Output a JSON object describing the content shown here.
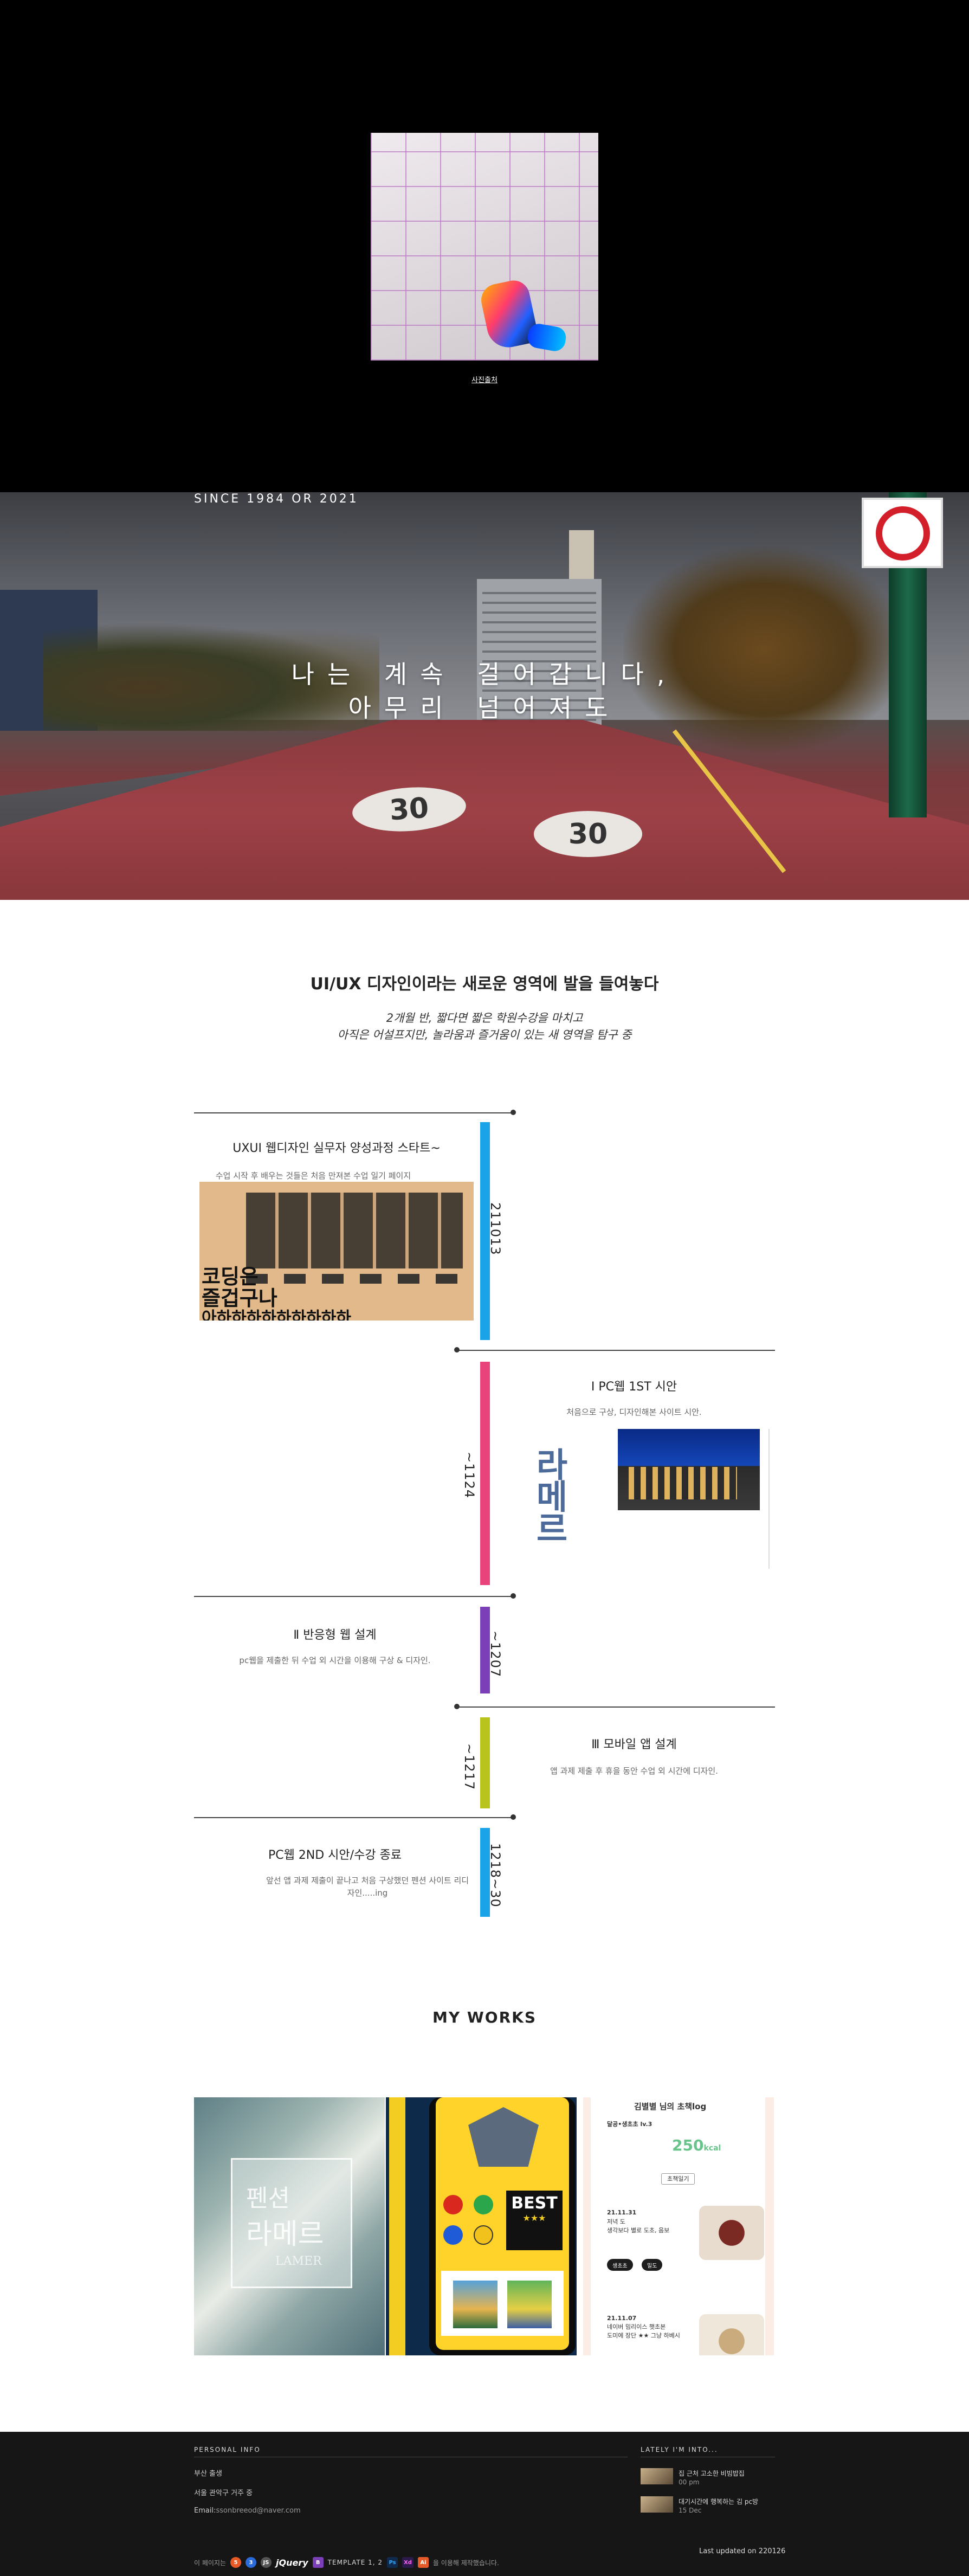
{
  "intro": {
    "caption": "사진출처"
  },
  "hero": {
    "since": "SINCE 1984 OR 2021",
    "line1": "나는 계속 걸어갑니다,",
    "line2": "아무리 넘어져도",
    "road_mark1": "30",
    "road_mark2": "30"
  },
  "about": {
    "title": "UI/UX 디자인이라는 새로운 영역에 발을 들여놓다",
    "sub1": "2개월 반, 짧다면 짧은 학원수강을 마치고",
    "sub2": "아직은 어설프지만, 놀라움과 즐거움이 있는 새 영역을 탐구 중"
  },
  "timeline": [
    {
      "date": "211013",
      "title": "UXUI 웹디자인 실무자 양성과정 스타트~",
      "desc": "수업 시작 후 배우는 것들은 처음 만져본 수업 일기 페이지",
      "thumb_text1": "코딩은",
      "thumb_text2": "즐겁구나",
      "thumb_text3": "아하하하하하하하하하",
      "color": "#1aa3e8"
    },
    {
      "date": "~1124",
      "title": "Ⅰ PC웹 1ST 시안",
      "desc": "처음으로 구상, 디자인해본 사이트 시안.",
      "thumb_logo": "라메르",
      "color": "#e8437a"
    },
    {
      "date": "~1207",
      "title": "Ⅱ 반응형 웹 설계",
      "desc": "pc웹을 제출한 뒤 수업 외 시간을 이용해 구상 & 디자인.",
      "color": "#7b3fb8"
    },
    {
      "date": "~1217",
      "title": "Ⅲ 모바일 앱 설계",
      "desc": "앱 과제 제출 후 휴을 동안 수업 외 시간에 디자인.",
      "color": "#b8c41d"
    },
    {
      "date": "1218~30",
      "title": "PC웹 2ND 시안/수강 종료",
      "desc1": "앞선 앱 과제 제출이 끝나고 처음 구상했던 펜션 사이트 리디",
      "desc2": "자인.....ing",
      "color": "#1aa3e8"
    }
  ],
  "works": {
    "title": "MY WORKS",
    "w1": {
      "name1": "펜션",
      "name2": "라메르",
      "name3": "LAMER"
    },
    "w2": {
      "best": "BEST",
      "best2": "★★★"
    },
    "w3": {
      "title": "김별별 님의 초책log",
      "tag": "달공•생초초 lv.3",
      "kcal": "250",
      "kcal_unit": "kcal",
      "btn": "초책일기",
      "e1_date": "21.11.31",
      "e1_line1": "저녁 도",
      "e1_line2": "생각보다 별로 도초, 음보",
      "pill1": "생초초",
      "pill2": "밀도",
      "e2_date": "21.11.07",
      "e2_line1": "네이버 밈리이스 햇초본",
      "e2_line2": "도미에 장단 ★★ 그냥 하베시"
    }
  },
  "footer": {
    "personal_head": "PERSONAL INFO",
    "birthplace": "부산 출생",
    "address": "서울 관악구 거주 중",
    "email_label": "Email:",
    "email": "ssonbreeod@naver.com",
    "lately_head": "LATELY I'M INTO...",
    "news": [
      {
        "title": "집 근처 고소한 비빔밥집",
        "date": "00 pm"
      },
      {
        "title": "대기시간에 행복하는 김 pc방",
        "date": "15 Dec"
      }
    ],
    "made_prefix": "이 페이지는",
    "template": "TEMPLATE 1, 2",
    "made_suffix": "을 이용해 제작했습니다.",
    "jquery": "jQuery",
    "updated": "Last updated on 220126"
  }
}
